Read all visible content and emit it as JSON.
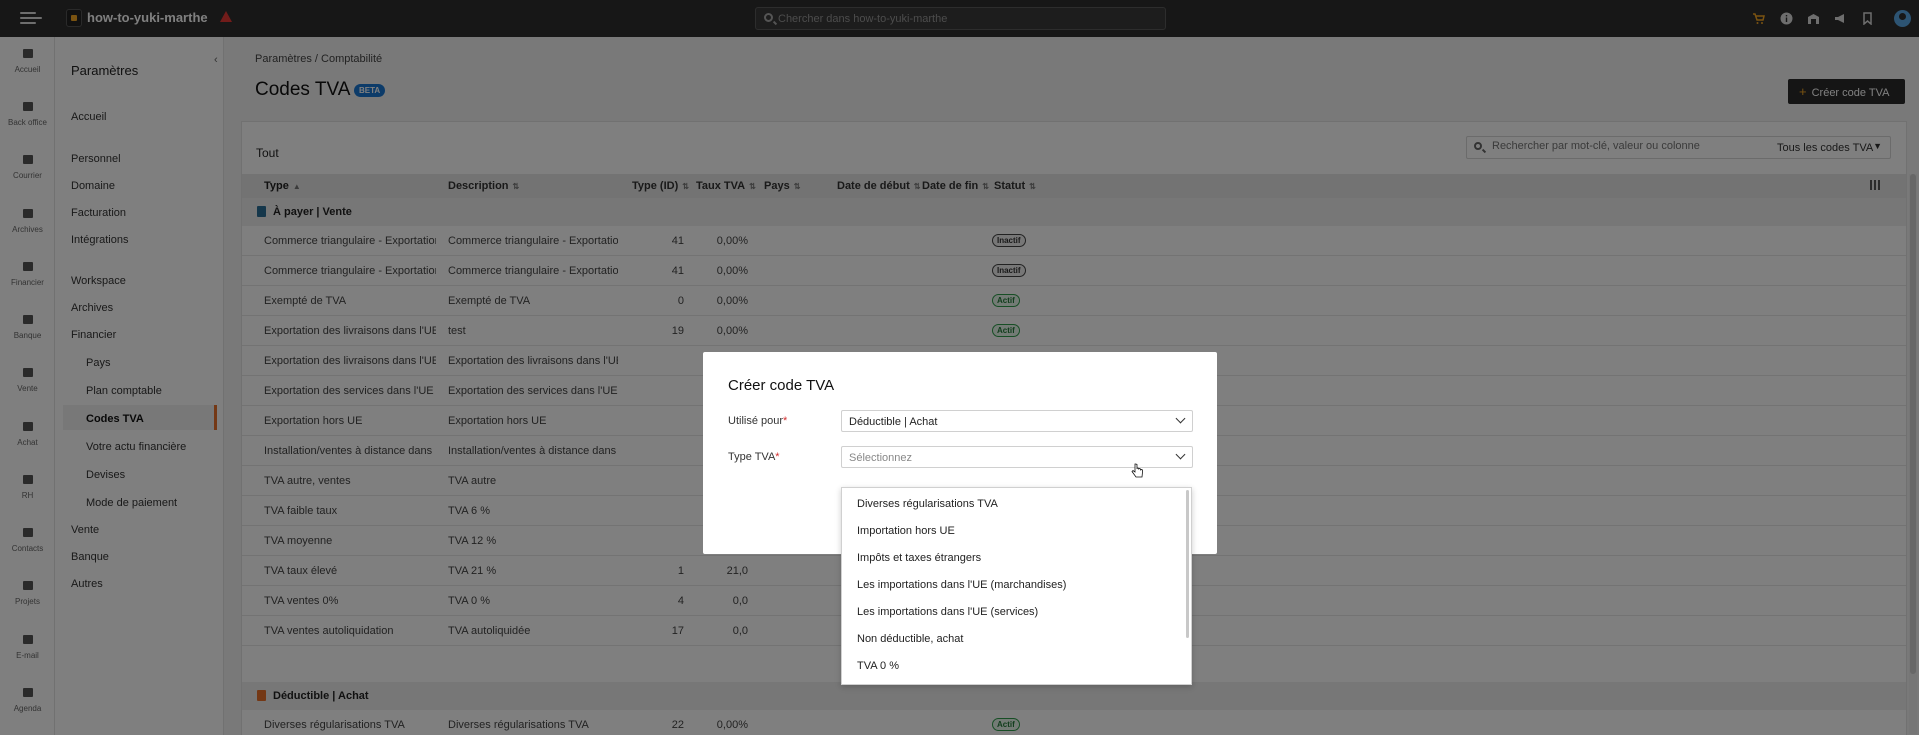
{
  "topbar": {
    "org_name": "how-to-yuki-marthe",
    "search_placeholder": "Chercher dans how-to-yuki-marthe",
    "icons": [
      "cart-icon",
      "info-icon",
      "building-icon",
      "megaphone-icon",
      "bookmark-icon",
      "user-avatar-icon"
    ]
  },
  "rail": {
    "items": [
      "Accueil",
      "Back office",
      "Courrier",
      "Archives",
      "Financier",
      "Banque",
      "Vente",
      "Achat",
      "RH",
      "Contacts",
      "Projets",
      "E-mail",
      "Agenda"
    ]
  },
  "sidepanel": {
    "title": "Paramètres",
    "items": [
      "Accueil",
      "Personnel",
      "Domaine",
      "Facturation",
      "Intégrations",
      "Workspace",
      "Archives",
      "Financier",
      "Vente",
      "Banque",
      "Autres"
    ],
    "sub_items": [
      "Pays",
      "Plan comptable",
      "Codes TVA",
      "Votre actu financière",
      "Devises",
      "Mode de paiement"
    ]
  },
  "main": {
    "breadcrumb": "Paramètres  /  Comptabilité",
    "title": "Codes TVA",
    "beta": "BETA",
    "create_button": "Créer code TVA",
    "card_title": "Tout",
    "filter_placeholder": "Rechercher par mot-clé, valeur ou colonne",
    "filter_dropdown": "Tous les codes TVA"
  },
  "table": {
    "columns": [
      "Type",
      "Description",
      "Type (ID)",
      "Taux TVA",
      "Pays",
      "Date de début",
      "Date de fin",
      "Statut"
    ],
    "group1": "À payer | Vente",
    "group2": "Déductible | Achat",
    "rows": [
      {
        "type": "Commerce triangulaire - Exportation de bi...",
        "desc": "Commerce triangulaire - Exportation de bi...",
        "id": "41",
        "rate": "0,00%",
        "status": "Inactif"
      },
      {
        "type": "Commerce triangulaire - Exportation de bi...",
        "desc": "Commerce triangulaire - Exportation de bi...",
        "id": "41",
        "rate": "0,00%",
        "status": "Inactif"
      },
      {
        "type": "Exempté de TVA",
        "desc": "Exempté de TVA",
        "id": "0",
        "rate": "0,00%",
        "status": "Actif"
      },
      {
        "type": "Exportation des livraisons dans l'UE",
        "desc": "test",
        "id": "19",
        "rate": "0,00%",
        "status": "Actif"
      },
      {
        "type": "Exportation des livraisons dans l'UE",
        "desc": "Exportation des livraisons dans l'UE",
        "id": "",
        "rate": "",
        "status": ""
      },
      {
        "type": "Exportation des services dans l'UE",
        "desc": "Exportation des services dans l'UE",
        "id": "",
        "rate": "",
        "status": ""
      },
      {
        "type": "Exportation hors UE",
        "desc": "Exportation hors UE",
        "id": "",
        "rate": "",
        "status": ""
      },
      {
        "type": "Installation/ventes à distance dans l'UE",
        "desc": "Installation/ventes à distance dans l'UE",
        "id": "",
        "rate": "",
        "status": ""
      },
      {
        "type": "TVA autre, ventes",
        "desc": "TVA autre",
        "id": "",
        "rate": "",
        "status": ""
      },
      {
        "type": "TVA faible taux",
        "desc": "TVA 6 %",
        "id": "",
        "rate": "",
        "status": ""
      },
      {
        "type": "TVA moyenne",
        "desc": "TVA 12 %",
        "id": "",
        "rate": "",
        "status": ""
      },
      {
        "type": "TVA taux élevé",
        "desc": "TVA 21 %",
        "id": "1",
        "rate": "21,0",
        "status": ""
      },
      {
        "type": "TVA ventes 0%",
        "desc": "TVA 0 %",
        "id": "4",
        "rate": "0,0",
        "status": ""
      },
      {
        "type": "TVA ventes autoliquidation",
        "desc": "TVA autoliquidée",
        "id": "17",
        "rate": "0,0",
        "status": ""
      }
    ],
    "row_last": {
      "type": "Diverses régularisations TVA",
      "desc": "Diverses régularisations TVA",
      "id": "22",
      "rate": "0,00%",
      "status": "Actif"
    }
  },
  "modal": {
    "title": "Créer code TVA",
    "used_for_label": "Utilisé pour",
    "used_for_value": "Déductible | Achat",
    "type_label": "Type TVA",
    "type_placeholder": "Sélectionnez",
    "required_mark": "*",
    "options": [
      "Diverses régularisations TVA",
      "Importation hors UE",
      "Impôts et taxes étrangers",
      "Les importations dans l'UE (marchandises)",
      "Les importations dans l'UE (services)",
      "Non déductible, achat",
      "TVA 0 %"
    ]
  },
  "colors": {
    "accent": "#e8702a",
    "active": "#2e9d4a",
    "beta": "#1976d2"
  }
}
